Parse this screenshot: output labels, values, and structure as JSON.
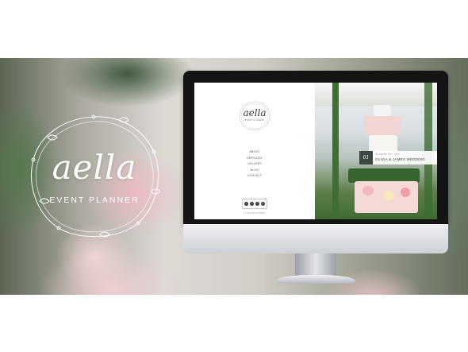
{
  "brand": {
    "name": "aella",
    "tagline": "EVENT PLANNER"
  },
  "site": {
    "logo": "aella",
    "logo_sub": "EVENT PLANNER",
    "nav": [
      {
        "label": "ABOUT"
      },
      {
        "label": "SERVICES"
      },
      {
        "label": "GALLERY"
      },
      {
        "label": "BLOG"
      },
      {
        "label": "CONTACT"
      }
    ],
    "social": [
      {
        "icon": "facebook-icon",
        "glyph": "f"
      },
      {
        "icon": "twitter-icon",
        "glyph": "t"
      },
      {
        "icon": "instagram-icon",
        "glyph": "i"
      },
      {
        "icon": "pinterest-icon",
        "glyph": "p"
      }
    ],
    "copyright": "© 2015 AELLA EVENTS",
    "event": {
      "number": "01",
      "date": "OCTOBER 5TH, 2015",
      "title": "OLIVIA & JAMES WEDDING"
    }
  },
  "colors": {
    "foliage": "#3f6d33",
    "badge_dark": "#3b4740",
    "bezel": "#141414"
  }
}
